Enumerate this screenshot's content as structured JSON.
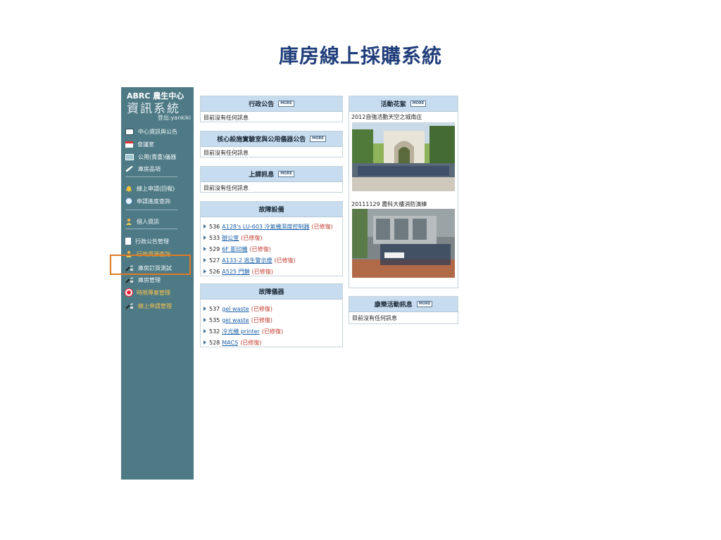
{
  "title": "庫房線上採購系統",
  "sidebar": {
    "brand_top": "ABRC 農生中心",
    "brand_main": "資訊系統",
    "logout": "登出:yankiki",
    "items": [
      {
        "label": "中心資訊與公告",
        "icon": "id-card-icon"
      },
      {
        "label": "會議室",
        "icon": "calendar-icon"
      },
      {
        "label": "公用(貴重)儀器",
        "icon": "monitor-icon"
      },
      {
        "label": "庫房品項",
        "icon": "pencil-icon"
      },
      {
        "label": "線上申請(回報)",
        "icon": "bell-icon"
      },
      {
        "label": "申請進度查詢",
        "icon": "globe-icon"
      },
      {
        "label": "個人資訊",
        "icon": "person-icon"
      },
      {
        "label": "行政公告管理",
        "icon": "document-icon"
      },
      {
        "label": "行政資源查詢",
        "icon": "person-icon"
      },
      {
        "label": "庫房訂貨測試",
        "icon": "tool-icon"
      },
      {
        "label": "庫房管理",
        "icon": "tool-icon"
      },
      {
        "label": "時限專案管理",
        "icon": "target-icon"
      },
      {
        "label": "線上申請管理",
        "icon": "tool-icon"
      }
    ]
  },
  "more_label": "MORE",
  "panels": {
    "admin_notice": {
      "title": "行政公告",
      "body": "目前沒有任何訊息"
    },
    "core_facility": {
      "title": "核心設施實驗室與公用儀器公告",
      "body": "目前沒有任何訊息"
    },
    "class_info": {
      "title": "上課訊息",
      "body": "目前沒有任何訊息"
    },
    "broken_equipment": {
      "title": "故障設備",
      "rows": [
        {
          "num": "536",
          "link": "A128's LU-603 冷氣機濕度控制器",
          "status": "(已修復)"
        },
        {
          "num": "533",
          "link": "辦公室",
          "status": "(已修復)"
        },
        {
          "num": "529",
          "link": "6F 影印機",
          "status": "(已修復)"
        },
        {
          "num": "527",
          "link": "A133-2 逃生警示燈",
          "status": "(已修復)"
        },
        {
          "num": "526",
          "link": "A525 門鎖",
          "status": "(已修復)"
        }
      ]
    },
    "broken_instruments": {
      "title": "故障儀器",
      "rows": [
        {
          "num": "537",
          "link": "gel waste",
          "status": "(已修復)"
        },
        {
          "num": "535",
          "link": "gel waste",
          "status": "(已修復)"
        },
        {
          "num": "532",
          "link": "冷光機 printer",
          "status": "(已修復)"
        },
        {
          "num": "528",
          "link": "MACS",
          "status": "(已修復)"
        }
      ]
    },
    "activity_highlights": {
      "title": "活動花絮",
      "caption1": "2012自強活動天空之城南庄",
      "caption2": "20111129 農科大樓消防演練"
    },
    "recreation": {
      "title": "康樂活動訊息",
      "body": "目前沒有任何訊息"
    }
  },
  "colors": {
    "sidebar_bg": "#4e7a86",
    "panel_header_bg": "#c7dcee",
    "title_color": "#1f3d7a",
    "link_color": "#1a5fa8",
    "status_color": "#c0392b",
    "highlight_border": "#e07b22"
  }
}
